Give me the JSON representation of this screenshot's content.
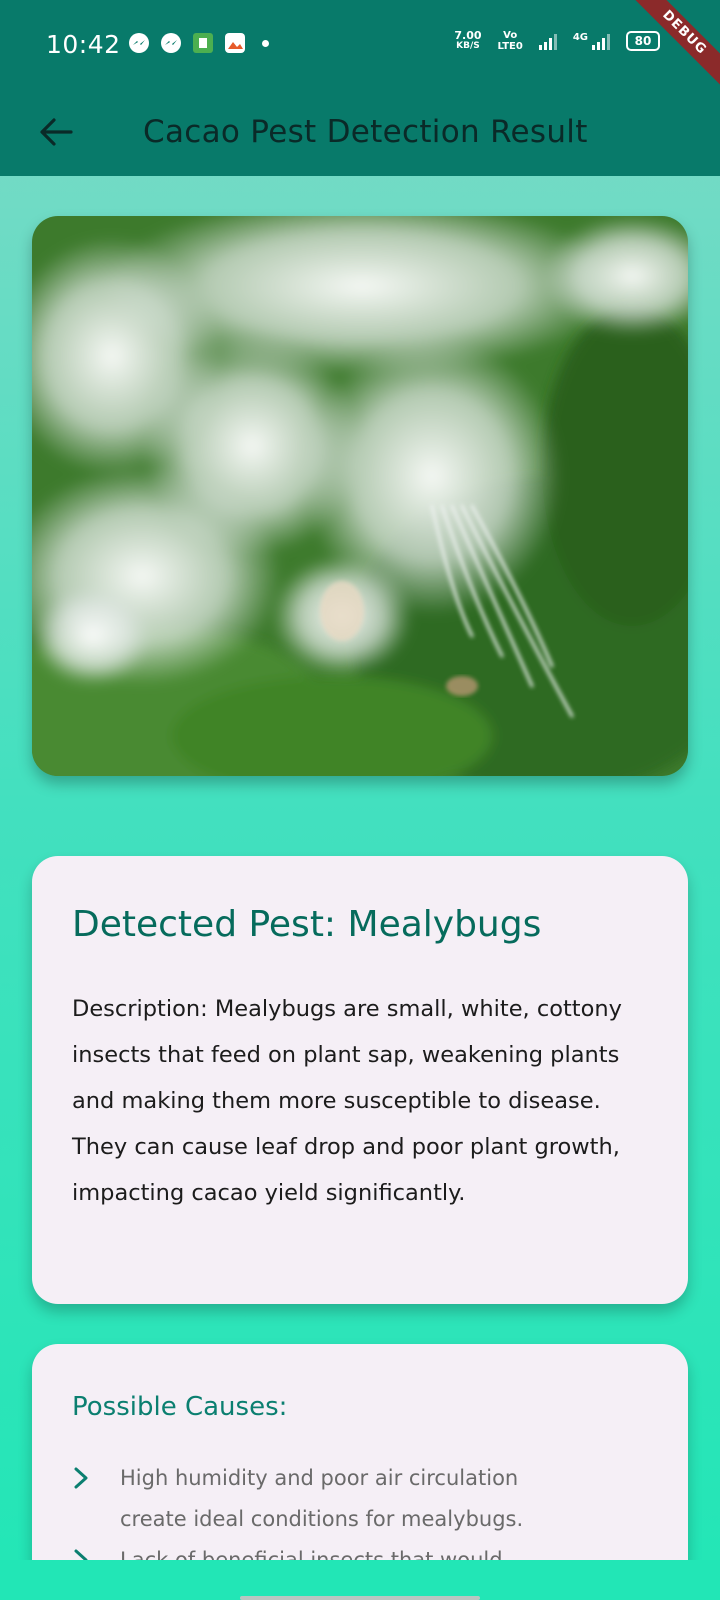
{
  "status_bar": {
    "time": "10:42",
    "speed_value": "7.00",
    "speed_unit": "KB/S",
    "volte_top": "Vo",
    "volte_bottom": "LTE0",
    "network": "4G",
    "battery": "80"
  },
  "debug_banner": "DEBUG",
  "app_bar": {
    "title": "Cacao Pest Detection Result",
    "back_icon": "arrow-left-icon"
  },
  "pest_card": {
    "title": "Detected Pest: Mealybugs",
    "description": "Description: Mealybugs are small, white, cottony insects that feed on plant sap, weakening plants and making them more susceptible to disease. They can cause leaf drop and poor plant growth, impacting cacao yield significantly."
  },
  "causes_card": {
    "title": "Possible Causes:",
    "items": [
      "High humidity and poor air circulation create ideal conditions for mealybugs.",
      "Lack of beneficial insects that would"
    ],
    "bullet_icon": "chevron-right-icon"
  },
  "colors": {
    "primary": "#087a6a",
    "accent_text": "#066b5c",
    "card_bg": "#f5eff6",
    "background_top": "#7fd9c7",
    "background_bottom": "#22e6b6"
  }
}
